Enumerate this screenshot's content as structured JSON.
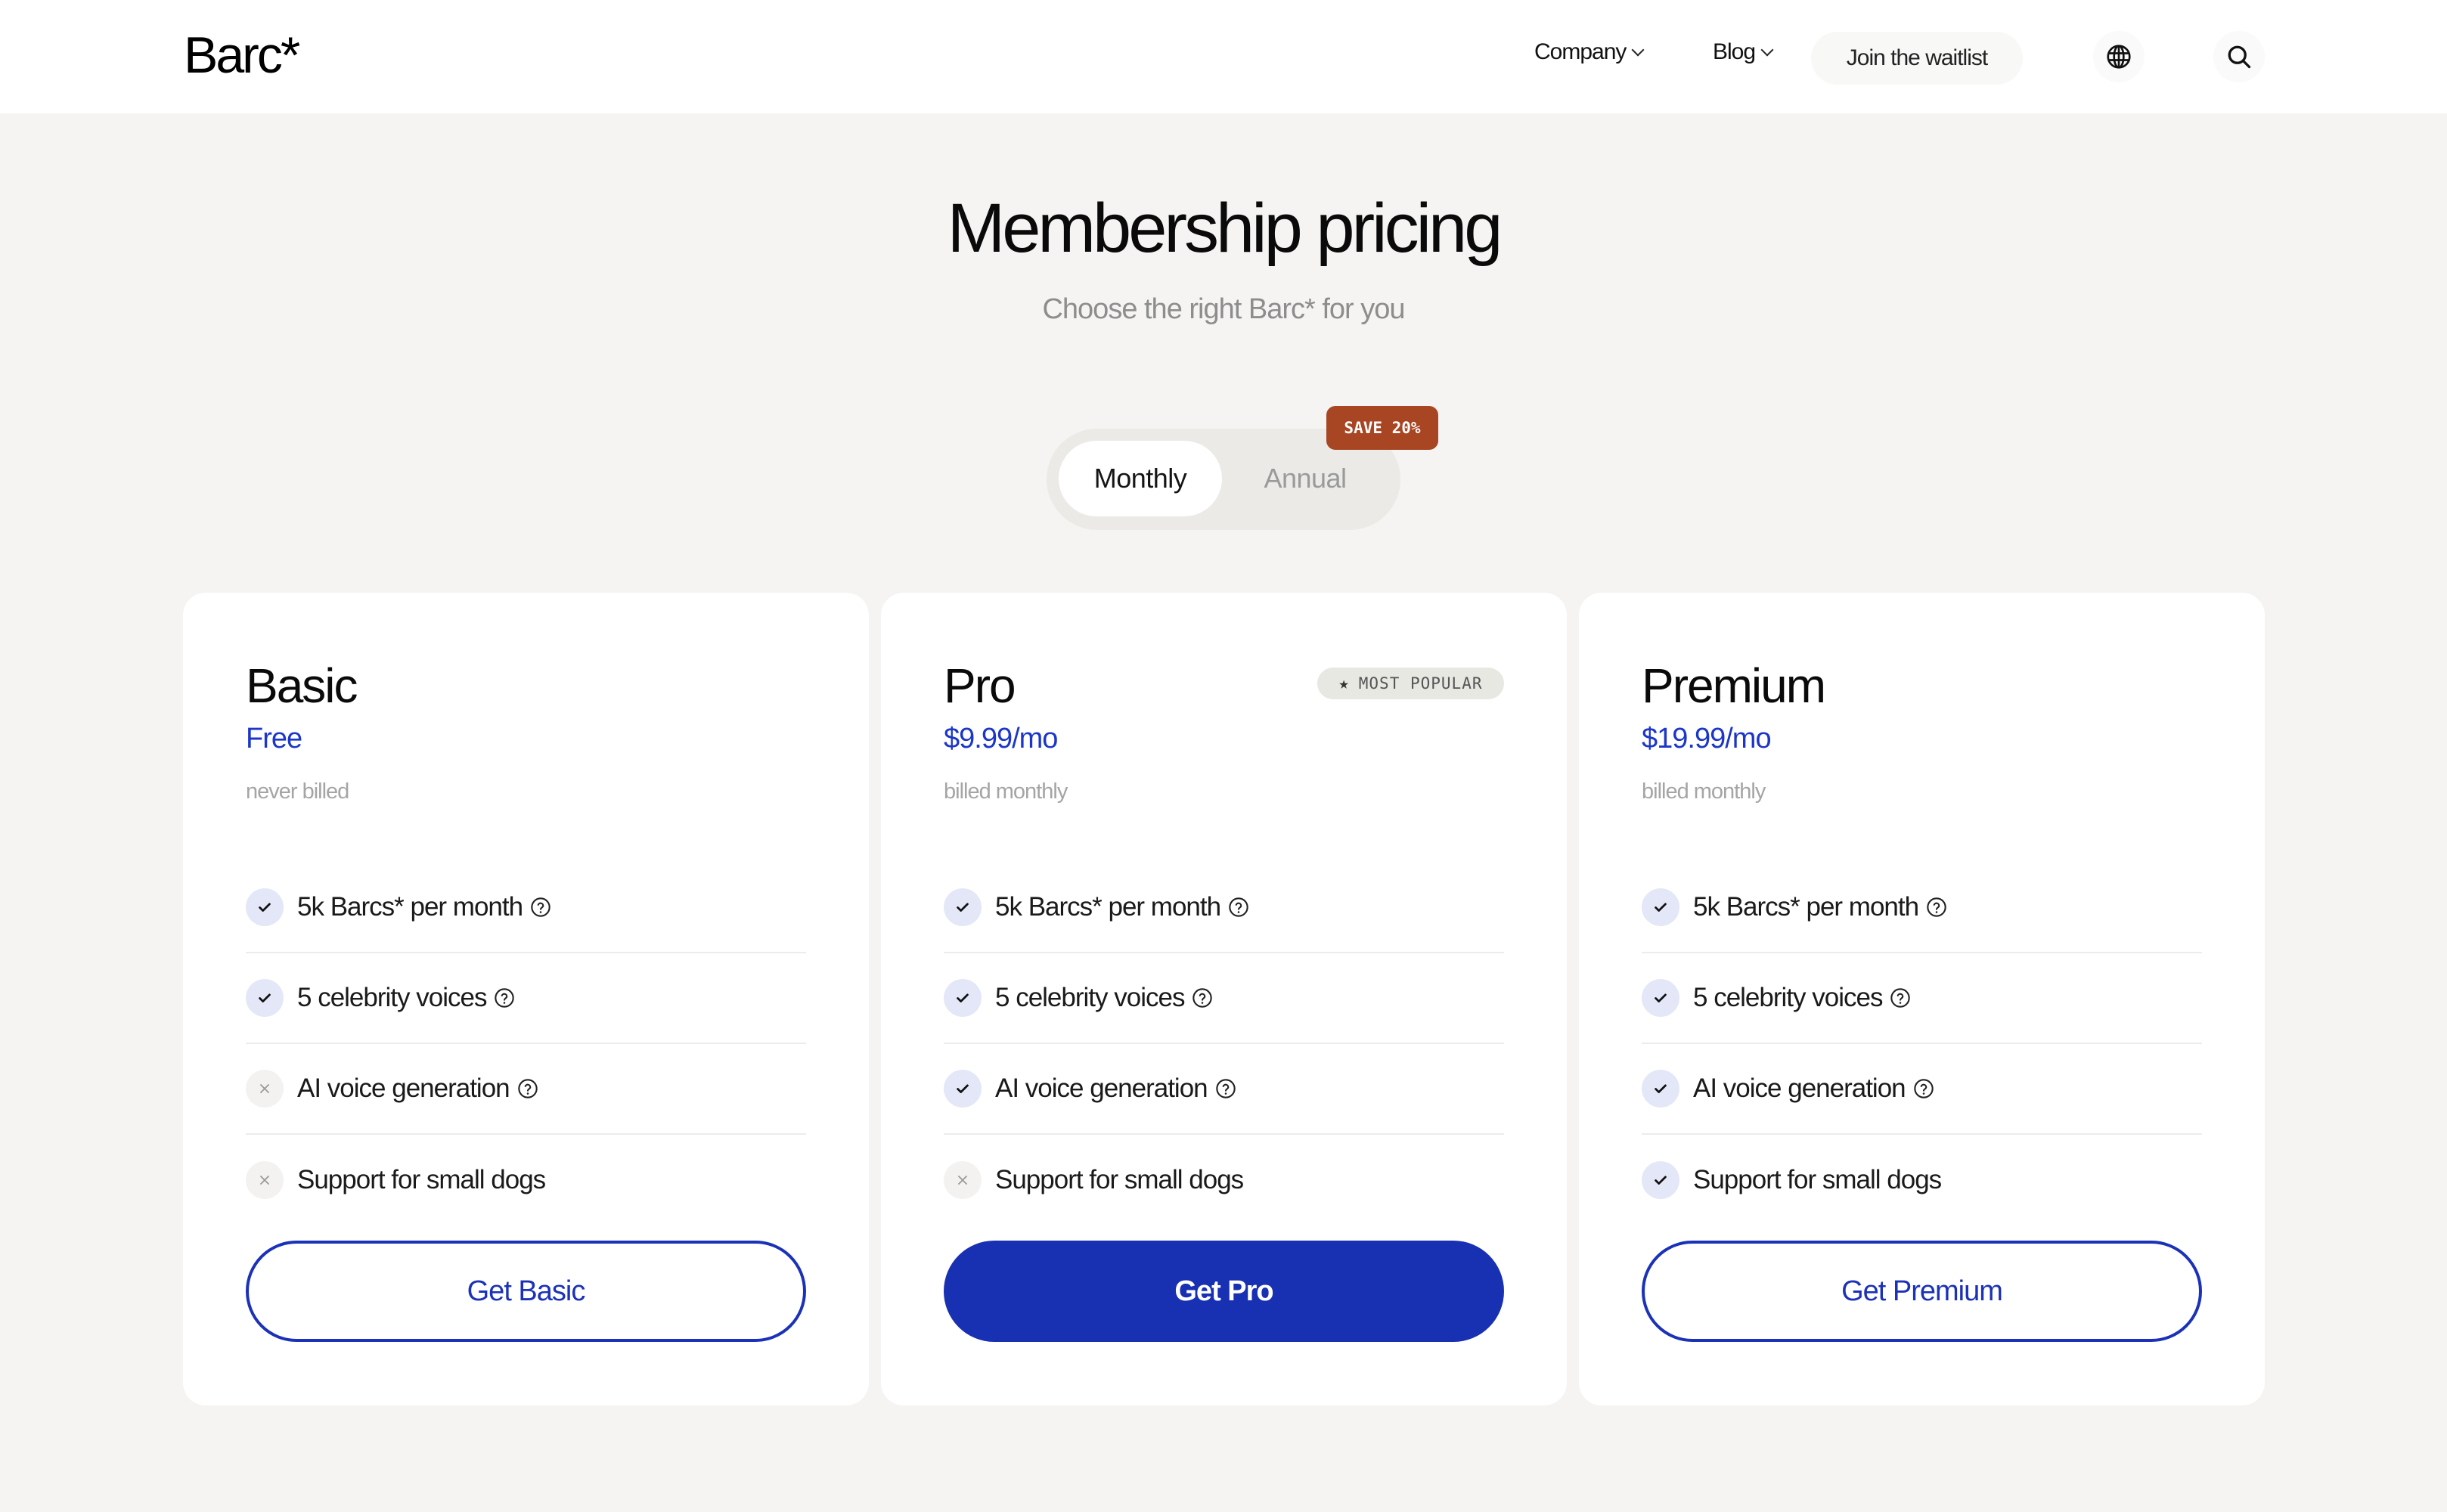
{
  "header": {
    "logo": "Barc*",
    "nav": [
      {
        "label": "Company",
        "has_dropdown": true
      },
      {
        "label": "Blog",
        "has_dropdown": true
      }
    ],
    "waitlist_label": "Join the waitlist",
    "icons": [
      "globe-icon",
      "search-icon"
    ]
  },
  "hero": {
    "title": "Membership pricing",
    "subtitle": "Choose the right Barc* for you"
  },
  "billing_toggle": {
    "options": [
      "Monthly",
      "Annual"
    ],
    "selected": "Monthly",
    "save_badge": "SAVE 20%"
  },
  "colors": {
    "accent": "#1830b2",
    "save_badge": "#a84522",
    "background": "#f5f4f2"
  },
  "plans": [
    {
      "name": "Basic",
      "price": "Free",
      "billing": "never billed",
      "badge": null,
      "features": [
        {
          "label": "5k Barcs* per month",
          "included": true,
          "help": true
        },
        {
          "label": "5 celebrity voices",
          "included": true,
          "help": true
        },
        {
          "label": "AI voice generation",
          "included": false,
          "help": true
        },
        {
          "label": "Support for small dogs",
          "included": false,
          "help": false
        }
      ],
      "cta": "Get Basic",
      "cta_style": "outline"
    },
    {
      "name": "Pro",
      "price": "$9.99/mo",
      "billing": "billed monthly",
      "badge": "MOST POPULAR",
      "features": [
        {
          "label": "5k Barcs* per month",
          "included": true,
          "help": true
        },
        {
          "label": "5 celebrity voices",
          "included": true,
          "help": true
        },
        {
          "label": "AI voice generation",
          "included": true,
          "help": true
        },
        {
          "label": "Support for small dogs",
          "included": false,
          "help": false
        }
      ],
      "cta": "Get Pro",
      "cta_style": "solid"
    },
    {
      "name": "Premium",
      "price": "$19.99/mo",
      "billing": "billed monthly",
      "badge": null,
      "features": [
        {
          "label": "5k Barcs* per month",
          "included": true,
          "help": true
        },
        {
          "label": "5 celebrity voices",
          "included": true,
          "help": true
        },
        {
          "label": "AI voice generation",
          "included": true,
          "help": true
        },
        {
          "label": "Support for small dogs",
          "included": true,
          "help": false
        }
      ],
      "cta": "Get Premium",
      "cta_style": "outline"
    }
  ]
}
